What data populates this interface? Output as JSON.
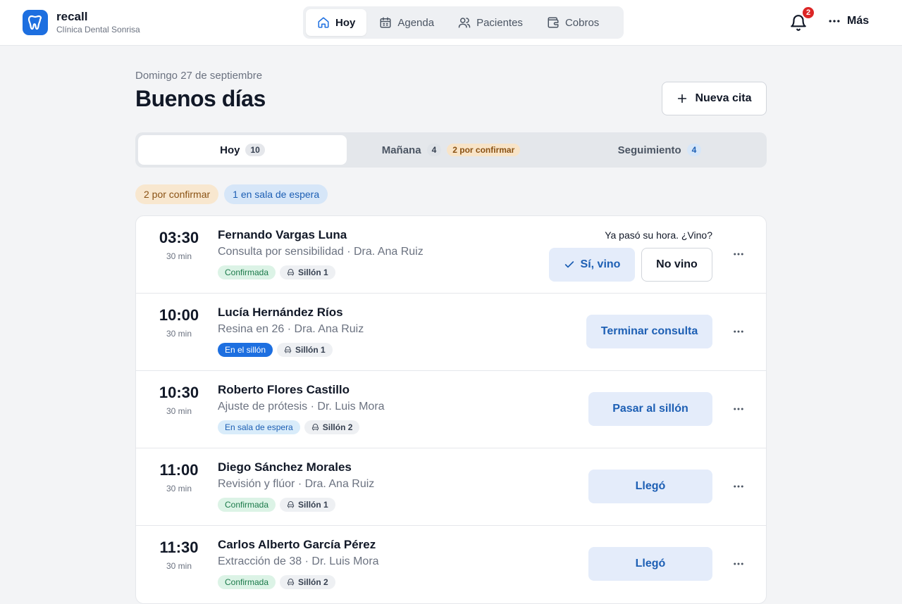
{
  "brand": {
    "name": "recall",
    "subtitle": "Clínica Dental Sonrisa"
  },
  "nav": [
    {
      "label": "Hoy",
      "icon": "home-icon",
      "active": true
    },
    {
      "label": "Agenda",
      "icon": "calendar-icon"
    },
    {
      "label": "Pacientes",
      "icon": "users-icon"
    },
    {
      "label": "Cobros",
      "icon": "wallet-icon"
    }
  ],
  "notifications": {
    "count": "2"
  },
  "more_label": "Más",
  "header": {
    "date": "Domingo 27 de septiembre",
    "greeting": "Buenos días",
    "new_label": "Nueva cita"
  },
  "tabs": [
    {
      "label": "Hoy",
      "count": "10"
    },
    {
      "label": "Mañana",
      "count": "4",
      "tag": "2 por confirmar"
    },
    {
      "label": "Seguimiento",
      "count": "4"
    }
  ],
  "chips": [
    "2 por confirmar",
    "1 en sala de espera"
  ],
  "appointments": [
    {
      "time": "03:30",
      "duration": "30 min",
      "name": "Fernando Vargas Luna",
      "desc": "Consulta por sensibilidad · Dra. Ana Ruiz",
      "status": "Confirmada",
      "chair": "Sillón 1",
      "prompt": "Ya pasó su hora. ¿Vino?",
      "yes_label": "Sí, vino",
      "no_label": "No vino"
    },
    {
      "time": "10:00",
      "duration": "30 min",
      "name": "Lucía Hernández Ríos",
      "desc": "Resina en 26 · Dra. Ana Ruiz",
      "status": "En el sillón",
      "chair": "Sillón 1",
      "action": "Terminar consulta"
    },
    {
      "time": "10:30",
      "duration": "30 min",
      "name": "Roberto Flores Castillo",
      "desc": "Ajuste de prótesis · Dr. Luis Mora",
      "status": "En sala de espera",
      "chair": "Sillón 2",
      "action": "Pasar al sillón"
    },
    {
      "time": "11:00",
      "duration": "30 min",
      "name": "Diego Sánchez Morales",
      "desc": "Revisión y flúor · Dra. Ana Ruiz",
      "status": "Confirmada",
      "chair": "Sillón 1",
      "action": "Llegó"
    },
    {
      "time": "11:30",
      "duration": "30 min",
      "name": "Carlos Alberto García Pérez",
      "desc": "Extracción de 38 · Dr. Luis Mora",
      "status": "Confirmada",
      "chair": "Sillón 2",
      "action": "Llegó"
    }
  ],
  "colors": {
    "accent": "#1d6fe0",
    "accent_soft": "#e4ecfa",
    "danger": "#dc2626"
  }
}
